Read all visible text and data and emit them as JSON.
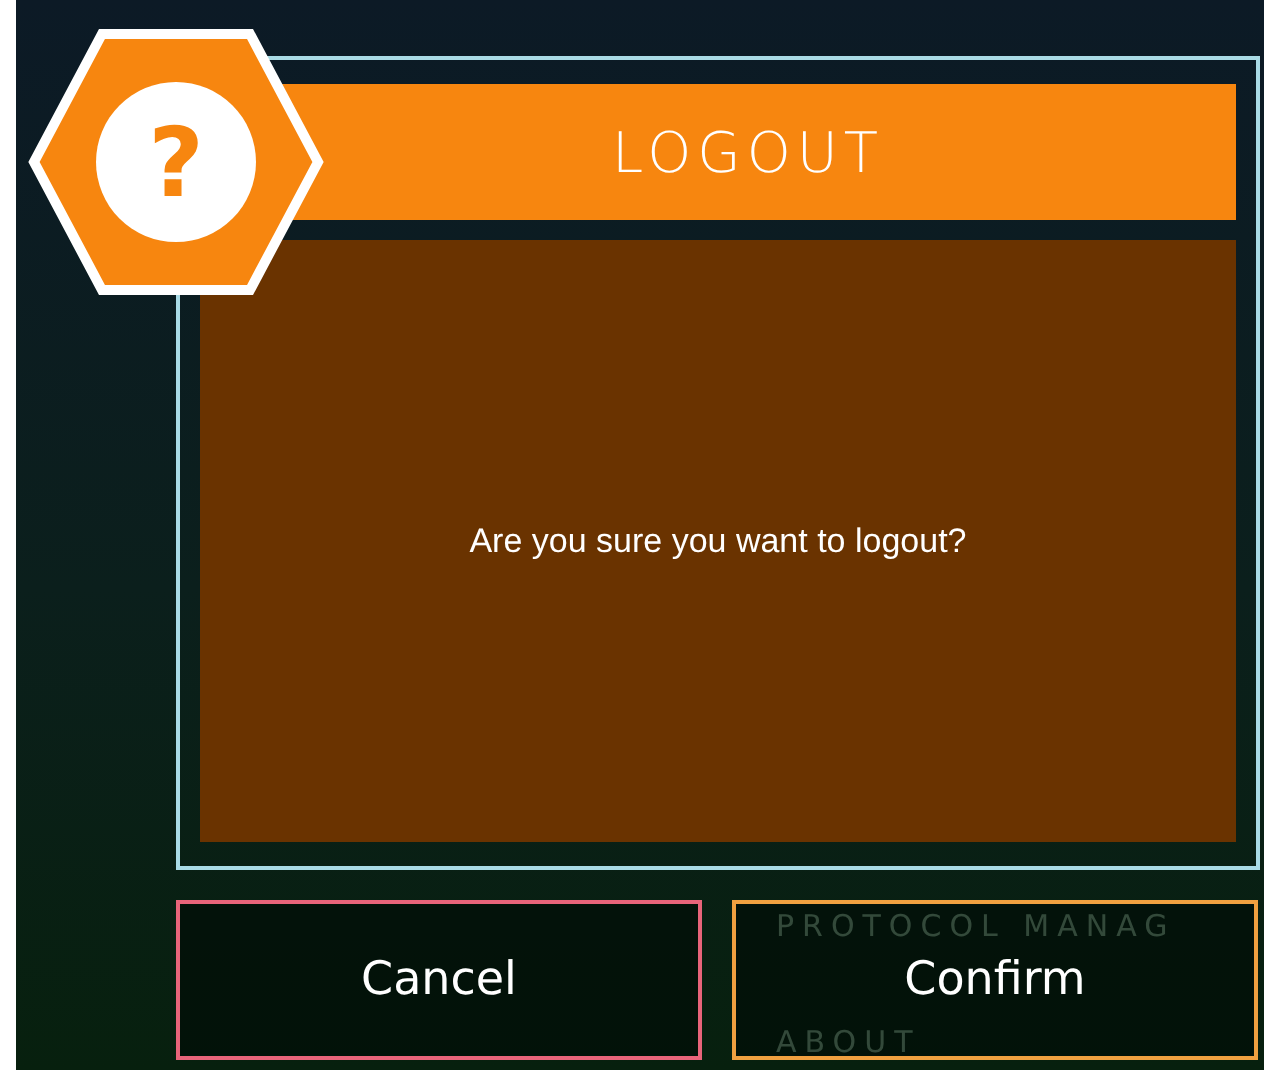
{
  "background_menu": [
    "PROTOCOL MANAG",
    "ABOUT"
  ],
  "dialog": {
    "title": "LOGOUT",
    "icon_text": "?",
    "message": "Are you sure you want to logout?"
  },
  "buttons": [
    {
      "label": "Cancel",
      "kind": "cancel"
    },
    {
      "label": "Confirm",
      "kind": "confirm"
    }
  ]
}
